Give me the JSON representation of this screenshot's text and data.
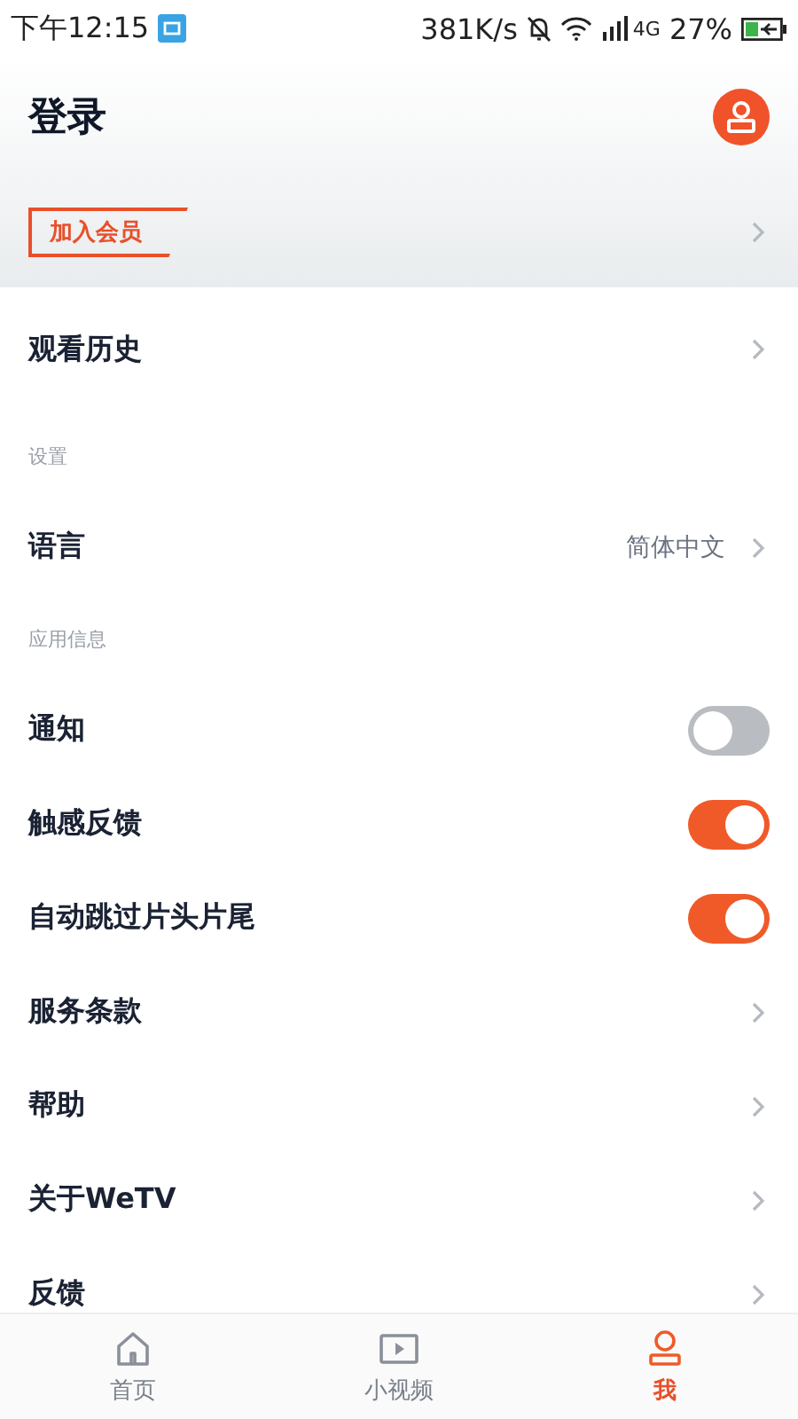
{
  "status_bar": {
    "time": "下午12:15",
    "speed": "381K/s",
    "network": "4G",
    "battery": "27%"
  },
  "header": {
    "title": "登录",
    "member_button": "加入会员"
  },
  "rows": [
    {
      "kind": "link",
      "label": "观看历史"
    },
    {
      "kind": "section",
      "label": "设置"
    },
    {
      "kind": "value",
      "label": "语言",
      "value": "简体中文"
    },
    {
      "kind": "section",
      "label": "应用信息"
    },
    {
      "kind": "toggle",
      "label": "通知",
      "on": false
    },
    {
      "kind": "toggle",
      "label": "触感反馈",
      "on": true
    },
    {
      "kind": "toggle",
      "label": "自动跳过片头片尾",
      "on": true
    },
    {
      "kind": "link",
      "label": "服务条款"
    },
    {
      "kind": "link",
      "label": "帮助"
    },
    {
      "kind": "link",
      "label": "关于WeTV"
    },
    {
      "kind": "link",
      "label": "反馈"
    }
  ],
  "nav": [
    {
      "label": "首页",
      "selected": false
    },
    {
      "label": "小视频",
      "selected": false
    },
    {
      "label": "我",
      "selected": true
    }
  ]
}
